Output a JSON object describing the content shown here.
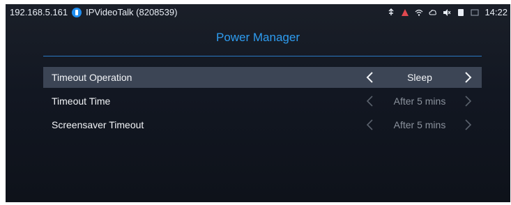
{
  "statusbar": {
    "ip": "192.168.5.161",
    "app": "IPVideoTalk (8208539)",
    "time": "14:22",
    "icons": [
      "usb-icon",
      "alert-icon",
      "wifi-icon",
      "cloud-icon",
      "mute-icon",
      "sim-icon",
      "screenshot-icon"
    ]
  },
  "page": {
    "title": "Power Manager"
  },
  "settings": [
    {
      "label": "Timeout Operation",
      "value": "Sleep",
      "selected": true
    },
    {
      "label": "Timeout Time",
      "value": "After 5 mins",
      "selected": false
    },
    {
      "label": "Screensaver Timeout",
      "value": "After 5 mins",
      "selected": false
    }
  ],
  "colors": {
    "accent": "#2e9cf0",
    "selected_row": "#3c4555",
    "dimmed_text": "#8b929d",
    "alert": "#e0484f"
  }
}
